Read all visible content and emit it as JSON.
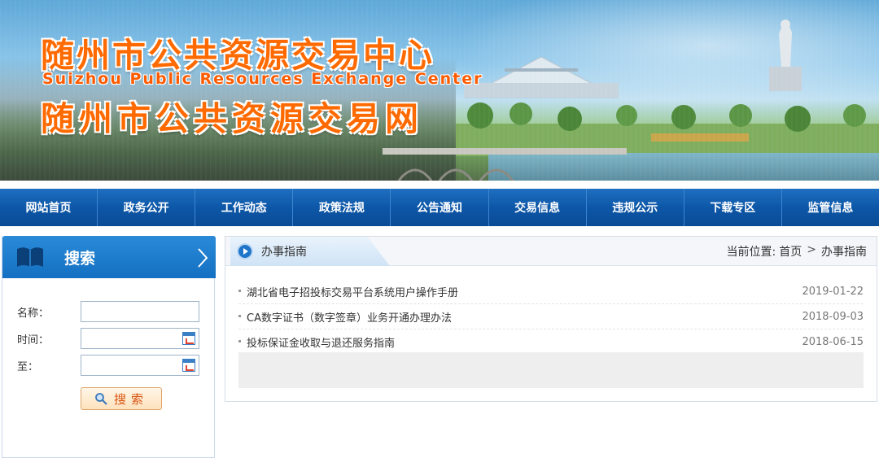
{
  "banner": {
    "title_cn": "随州市公共资源交易中心",
    "title_en": "Suizhou Public Resources Exchange Center",
    "title_cn2": "随州市公共资源交易网"
  },
  "nav": {
    "items": [
      {
        "label": "网站首页"
      },
      {
        "label": "政务公开"
      },
      {
        "label": "工作动态"
      },
      {
        "label": "政策法规"
      },
      {
        "label": "公告通知"
      },
      {
        "label": "交易信息"
      },
      {
        "label": "违规公示"
      },
      {
        "label": "下载专区"
      },
      {
        "label": "监管信息"
      }
    ]
  },
  "sidebar": {
    "title": "搜索",
    "name_label": "名称：",
    "name_value": "",
    "time_label": "时间：",
    "time_value": "",
    "to_label": "至：",
    "to_value": "",
    "search_button": "搜索"
  },
  "main": {
    "tab_title": "办事指南",
    "breadcrumb": {
      "prefix": "当前位置:",
      "home": "首页",
      "separator": ">",
      "current": "办事指南"
    },
    "items": [
      {
        "title": "湖北省电子招投标交易平台系统用户操作手册",
        "date": "2019-01-22"
      },
      {
        "title": "CA数字证书（数字签章）业务开通办理办法",
        "date": "2018-09-03"
      },
      {
        "title": "投标保证金收取与退还服务指南",
        "date": "2018-06-15"
      }
    ]
  },
  "colors": {
    "nav_blue": "#0d57a8",
    "title_orange": "#ff6a00",
    "button_text": "#d9530f"
  }
}
